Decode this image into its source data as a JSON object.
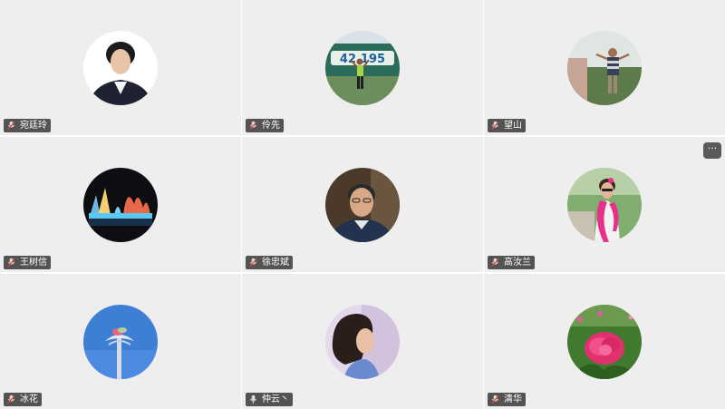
{
  "participants": [
    {
      "name": "宛廷玲",
      "mic": "mic-muted-icon",
      "avatar": "portrait-photo"
    },
    {
      "name": "伶先",
      "mic": "mic-muted-icon",
      "avatar": "marathon-photo"
    },
    {
      "name": "望山",
      "mic": "mic-muted-icon",
      "avatar": "outdoor-man-photo"
    },
    {
      "name": "王树信",
      "mic": "mic-muted-icon",
      "avatar": "night-lights-photo"
    },
    {
      "name": "徐忠斌",
      "mic": "mic-muted-icon",
      "avatar": "man-portrait-photo"
    },
    {
      "name": "高汝兰",
      "mic": "mic-muted-icon",
      "avatar": "woman-pink-scarf-photo"
    },
    {
      "name": "冰花",
      "mic": "mic-muted-icon",
      "avatar": "sculpture-sky-photo"
    },
    {
      "name": "仲云丶",
      "mic": "mic-on-icon",
      "avatar": "woman-profile-photo"
    },
    {
      "name": "清华",
      "mic": "mic-muted-icon",
      "avatar": "peony-flower-photo"
    }
  ],
  "more_button": {
    "label": "···"
  },
  "colors": {
    "tile_bg": "#eeeeee",
    "name_tag_bg": "#2d2d2d",
    "muted_mic": "#e8453c",
    "more_button_bg": "#5a5a5a"
  }
}
